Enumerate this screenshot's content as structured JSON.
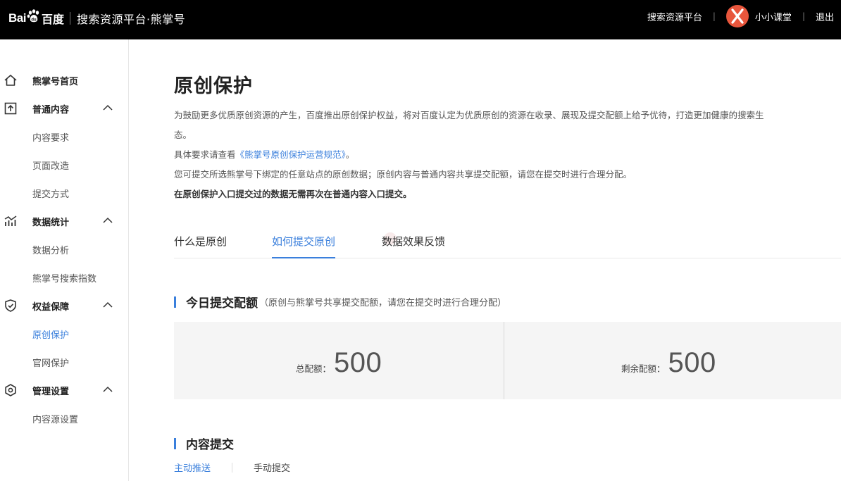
{
  "header": {
    "logo_bai": "Bai",
    "logo_du": "百度",
    "platform_title": "搜索资源平台·熊掌号",
    "nav_link": "搜索资源平台",
    "divider": "|",
    "username": "小小课堂",
    "logout": "退出",
    "avatar_color": "#e8563c"
  },
  "sidebar": {
    "home": "熊掌号首页",
    "groups": [
      {
        "title": "普通内容",
        "items": [
          "内容要求",
          "页面改造",
          "提交方式"
        ]
      },
      {
        "title": "数据统计",
        "items": [
          "数据分析",
          "熊掌号搜索指数"
        ]
      },
      {
        "title": "权益保障",
        "items": [
          "原创保护",
          "官网保护"
        ]
      },
      {
        "title": "管理设置",
        "items": [
          "内容源设置"
        ]
      }
    ],
    "active_item": "原创保护",
    "active_color": "#3a7fdc"
  },
  "main": {
    "title": "原创保护",
    "desc1": "为鼓励更多优质原创资源的产生，百度推出原创保护权益，将对百度认定为优质原创的资源在收录、展现及提交配额上给予优待，打造更加健康的搜索生",
    "desc1b": "态。",
    "desc2_prefix": "具体要求请查看",
    "desc2_link": "《熊掌号原创保护运营规范》",
    "desc2_suffix": "。",
    "desc3": "您可提交所选熊掌号下绑定的任意站点的原创数据；原创内容与普通内容共享提交配额，请您在提交时进行合理分配。",
    "desc4": "在原创保护入口提交过的数据无需再次在普通内容入口提交。",
    "tabs": [
      "什么是原创",
      "如何提交原创",
      "数据效果反馈"
    ],
    "active_tab": "如何提交原创",
    "quota_section": {
      "title": "今日提交配额",
      "note": "（原创与熊掌号共享提交配额，请您在提交时进行合理分配）",
      "total_label": "总配额：",
      "total_value": "500",
      "remaining_label": "剩余配额：",
      "remaining_value": "500"
    },
    "content_section": {
      "title": "内容提交",
      "subtabs": [
        "主动推送",
        "手动提交"
      ],
      "active_subtab": "主动推送"
    }
  }
}
